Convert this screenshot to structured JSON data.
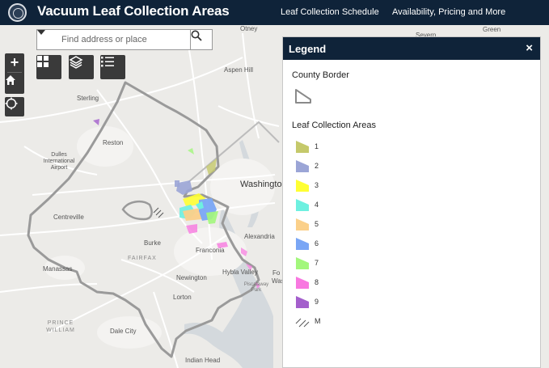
{
  "header": {
    "title": "Vacuum Leaf Collection Areas",
    "nav": [
      {
        "label": "Leaf Collection Schedule"
      },
      {
        "label": "Availability, Pricing and More"
      }
    ]
  },
  "map": {
    "labels": [
      {
        "text": "Otney"
      },
      {
        "text": "Aspen Hill"
      },
      {
        "text": "Sterling"
      },
      {
        "text": "Reston"
      },
      {
        "text": "Dulles International Airport"
      },
      {
        "text": "Washington"
      },
      {
        "text": "Centreville"
      },
      {
        "text": "Burke"
      },
      {
        "text": "Alexandria"
      },
      {
        "text": "FAIRFAX"
      },
      {
        "text": "Franconia"
      },
      {
        "text": "Manassas"
      },
      {
        "text": "Hybla Valley"
      },
      {
        "text": "Newington"
      },
      {
        "text": "Lorton"
      },
      {
        "text": "PRINCE WILLIAM"
      },
      {
        "text": "Dale City"
      },
      {
        "text": "Piscataway Park"
      },
      {
        "text": "Indian Head"
      },
      {
        "text": "Green"
      },
      {
        "text": "Severn"
      },
      {
        "text": "Fo"
      },
      {
        "text": "Washi"
      }
    ]
  },
  "controls": {
    "zoom_in": "+",
    "zoom_out": "−",
    "search_placeholder": "Find address or place"
  },
  "legend": {
    "title": "Legend",
    "close": "×",
    "sections": {
      "county_border": "County Border",
      "leaf_areas": "Leaf Collection Areas"
    },
    "items": [
      {
        "label": "1",
        "color": "#c5c96b"
      },
      {
        "label": "2",
        "color": "#9ba5d6"
      },
      {
        "label": "3",
        "color": "#ffff33"
      },
      {
        "label": "4",
        "color": "#6ef0e0"
      },
      {
        "label": "5",
        "color": "#fbd08a"
      },
      {
        "label": "6",
        "color": "#7aa6f5"
      },
      {
        "label": "7",
        "color": "#a3f77c"
      },
      {
        "label": "8",
        "color": "#f878e0"
      },
      {
        "label": "9",
        "color": "#a45fcc"
      },
      {
        "label": "M",
        "color": "hatch"
      }
    ]
  },
  "colors": {
    "header_bg": "#0f2339",
    "map_bg": "#ecebe8",
    "county_border": "#9a9a9a",
    "water": "#d4d9dd"
  }
}
